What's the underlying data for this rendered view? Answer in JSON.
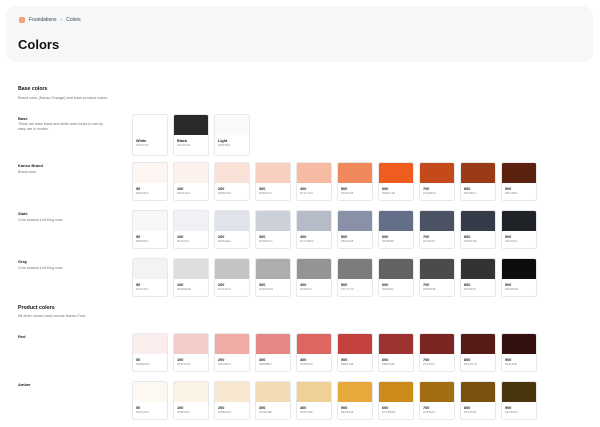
{
  "breadcrumb": {
    "parent": "Foundations",
    "separator": "›",
    "current": "Colors"
  },
  "page": {
    "title": "Colors"
  },
  "sections": {
    "base": {
      "title": "Base colors",
      "description": "Brand color (Kanso Orange) and base product colors."
    },
    "product": {
      "title": "Product colors",
      "description": "All other colors used across Kanso Fork."
    }
  },
  "rows": {
    "base": {
      "label": "Base",
      "description": "These are base black and white color tones to use by easy use in modes.",
      "swatches": [
        {
          "name": "White",
          "hex": "#FFFFFF",
          "color": "#ffffff"
        },
        {
          "name": "Black",
          "hex": "#1D1D1D",
          "color": "#2a2a2a"
        },
        {
          "name": "Light",
          "hex": "#F8F8F8",
          "color": "#fafafa"
        }
      ]
    },
    "kanso": {
      "label": "Kanso Brand",
      "description": "Brand color",
      "swatches": [
        {
          "name": "50",
          "hex": "#FEF6F3",
          "color": "#fef6f3"
        },
        {
          "name": "100",
          "hex": "#FDF1EC",
          "color": "#fdf1ec"
        },
        {
          "name": "200",
          "hex": "#FBE2D9",
          "color": "#fbe2d9"
        },
        {
          "name": "300",
          "hex": "#F9D2C2",
          "color": "#f8d0bf"
        },
        {
          "name": "400",
          "hex": "#F7C1AA",
          "color": "#f5bba3"
        },
        {
          "name": "500",
          "hex": "#F29F7B",
          "color": "#f0885c"
        },
        {
          "name": "600",
          "hex": "#EE5C1E",
          "color": "#ee5c1e"
        },
        {
          "name": "700",
          "hex": "#CE4B13",
          "color": "#c5491a"
        },
        {
          "name": "800",
          "hex": "#993B1A",
          "color": "#9a3b17"
        },
        {
          "name": "900",
          "hex": "#5F200E",
          "color": "#5a220f"
        }
      ]
    },
    "slate": {
      "label": "Slate",
      "description": "Core product Loff-King color",
      "swatches": [
        {
          "name": "50",
          "hex": "#F8F9FA",
          "color": "#f7f8fa"
        },
        {
          "name": "100",
          "hex": "#F1F2F4",
          "color": "#f0f1f4"
        },
        {
          "name": "200",
          "hex": "#E2E4EA",
          "color": "#e0e3e9"
        },
        {
          "name": "300",
          "hex": "#D0D4DC",
          "color": "#cbd0d9"
        },
        {
          "name": "400",
          "hex": "#C7CBD3",
          "color": "#b5bcc8"
        },
        {
          "name": "500",
          "hex": "#8A94A8",
          "color": "#8891a7"
        },
        {
          "name": "600",
          "hex": "#646F88",
          "color": "#636e88"
        },
        {
          "name": "700",
          "hex": "#4A5163",
          "color": "#4a5264"
        },
        {
          "name": "800",
          "hex": "#363C4B",
          "color": "#353b49"
        },
        {
          "name": "900",
          "hex": "#1E2226",
          "color": "#1f2227"
        }
      ]
    },
    "gray": {
      "label": "Gray",
      "description": "Core product Loff-King color",
      "swatches": [
        {
          "name": "50",
          "hex": "#F3F3F3",
          "color": "#f3f3f3"
        },
        {
          "name": "100",
          "hex": "#DEDEDE",
          "color": "#dedede"
        },
        {
          "name": "200",
          "hex": "#C4C4C4",
          "color": "#c4c4c4"
        },
        {
          "name": "300",
          "hex": "#ADADAD",
          "color": "#adadad"
        },
        {
          "name": "400",
          "hex": "#949494",
          "color": "#949494"
        },
        {
          "name": "500",
          "hex": "#7C7C7C",
          "color": "#7c7c7c"
        },
        {
          "name": "600",
          "hex": "#626262",
          "color": "#626262"
        },
        {
          "name": "700",
          "hex": "#4B4B4B",
          "color": "#4b4b4b"
        },
        {
          "name": "800",
          "hex": "#333333",
          "color": "#333333"
        },
        {
          "name": "900",
          "hex": "#0D0D0D",
          "color": "#0d0d0d"
        }
      ]
    },
    "red": {
      "label": "Red",
      "description": "",
      "swatches": [
        {
          "name": "50",
          "hex": "#FBEFED",
          "color": "#fbefed"
        },
        {
          "name": "100",
          "hex": "#F5CDC8",
          "color": "#f5cdc8"
        },
        {
          "name": "200",
          "hex": "#EFABA4",
          "color": "#efaba4"
        },
        {
          "name": "300",
          "hex": "#E6888D",
          "color": "#e58884"
        },
        {
          "name": "400",
          "hex": "#DD6660",
          "color": "#dd6660"
        },
        {
          "name": "500",
          "hex": "#BE4348",
          "color": "#c4423e"
        },
        {
          "name": "600",
          "hex": "#9B2F2B",
          "color": "#9e322e"
        },
        {
          "name": "700",
          "hex": "#7A2521",
          "color": "#7a2521"
        },
        {
          "name": "800",
          "hex": "#5A1C1E",
          "color": "#561b17"
        },
        {
          "name": "900",
          "hex": "#34110E",
          "color": "#34110e"
        }
      ]
    },
    "amber": {
      "label": "Amber",
      "description": "",
      "swatches": [
        {
          "name": "50",
          "hex": "#FDFAF0",
          "color": "#fdf9f1"
        },
        {
          "name": "100",
          "hex": "#FBF5EC",
          "color": "#fbf3e6"
        },
        {
          "name": "200",
          "hex": "#F8EAD9",
          "color": "#f7e8cf"
        },
        {
          "name": "300",
          "hex": "#F1E2BE",
          "color": "#f3dcb4"
        },
        {
          "name": "400",
          "hex": "#F0CD9F",
          "color": "#efd096"
        },
        {
          "name": "500",
          "hex": "#E7B248",
          "color": "#e6a93a"
        },
        {
          "name": "600",
          "hex": "#CC8B1B",
          "color": "#cc8b1b"
        },
        {
          "name": "700",
          "hex": "#A36E12",
          "color": "#a36d12"
        },
        {
          "name": "800",
          "hex": "#7A5A0F",
          "color": "#795210"
        },
        {
          "name": "900",
          "hex": "#4A3A0C",
          "color": "#4a360c"
        }
      ]
    }
  }
}
